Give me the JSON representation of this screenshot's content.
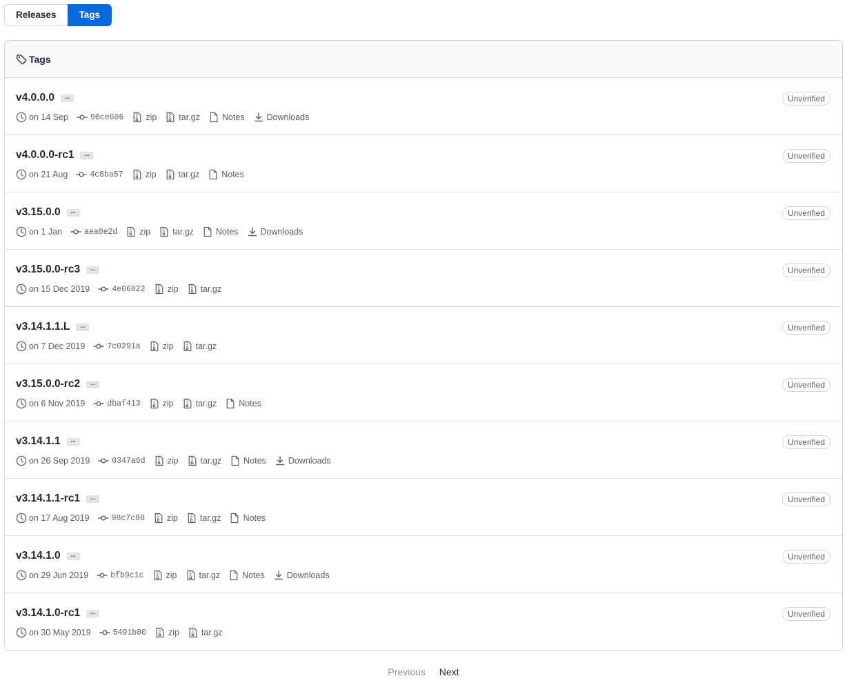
{
  "subnav": {
    "releases_label": "Releases",
    "tags_label": "Tags"
  },
  "box": {
    "title": "Tags"
  },
  "tags": [
    {
      "name": "v4.0.0.0",
      "date": "on 14 Sep",
      "sha": "90ce606",
      "zip": "zip",
      "targz": "tar.gz",
      "notes": "Notes",
      "downloads": "Downloads",
      "badge": "Unverified"
    },
    {
      "name": "v4.0.0.0-rc1",
      "date": "on 21 Aug",
      "sha": "4c8ba57",
      "zip": "zip",
      "targz": "tar.gz",
      "notes": "Notes",
      "badge": "Unverified"
    },
    {
      "name": "v3.15.0.0",
      "date": "on 1 Jan",
      "sha": "aea0e2d",
      "zip": "zip",
      "targz": "tar.gz",
      "notes": "Notes",
      "downloads": "Downloads",
      "badge": "Unverified"
    },
    {
      "name": "v3.15.0.0-rc3",
      "date": "on 15 Dec 2019",
      "sha": "4e06022",
      "zip": "zip",
      "targz": "tar.gz",
      "badge": "Unverified"
    },
    {
      "name": "v3.14.1.1.L",
      "date": "on 7 Dec 2019",
      "sha": "7c0291a",
      "zip": "zip",
      "targz": "tar.gz",
      "badge": "Unverified"
    },
    {
      "name": "v3.15.0.0-rc2",
      "date": "on 6 Nov 2019",
      "sha": "dbaf413",
      "zip": "zip",
      "targz": "tar.gz",
      "notes": "Notes",
      "badge": "Unverified"
    },
    {
      "name": "v3.14.1.1",
      "date": "on 26 Sep 2019",
      "sha": "0347a6d",
      "zip": "zip",
      "targz": "tar.gz",
      "notes": "Notes",
      "downloads": "Downloads",
      "badge": "Unverified"
    },
    {
      "name": "v3.14.1.1-rc1",
      "date": "on 17 Aug 2019",
      "sha": "98c7c98",
      "zip": "zip",
      "targz": "tar.gz",
      "notes": "Notes",
      "badge": "Unverified"
    },
    {
      "name": "v3.14.1.0",
      "date": "on 29 Jun 2019",
      "sha": "bfb9c1c",
      "zip": "zip",
      "targz": "tar.gz",
      "notes": "Notes",
      "downloads": "Downloads",
      "badge": "Unverified"
    },
    {
      "name": "v3.14.1.0-rc1",
      "date": "on 30 May 2019",
      "sha": "5491b80",
      "zip": "zip",
      "targz": "tar.gz",
      "badge": "Unverified"
    }
  ],
  "pagination": {
    "previous": "Previous",
    "next": "Next"
  },
  "colors": {
    "accent": "#0969da",
    "border": "#d0d7de",
    "muted": "#57606a"
  }
}
